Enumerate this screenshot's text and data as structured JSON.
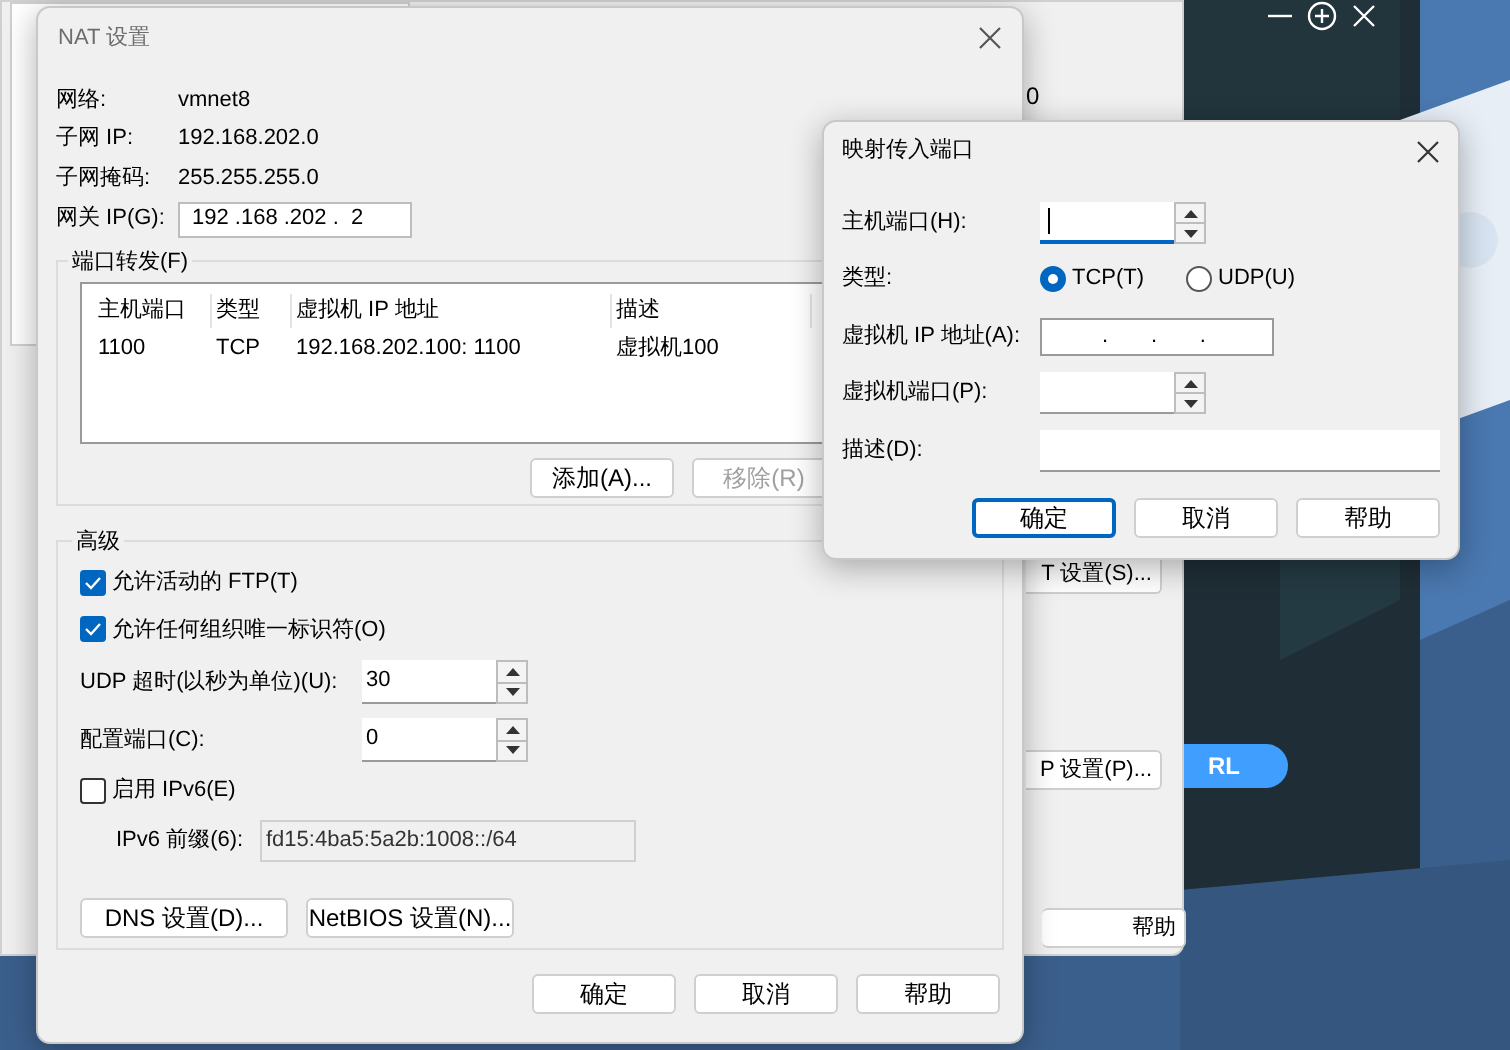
{
  "background_window": {
    "value_fragment": "0",
    "buttons": [
      {
        "label": "T 设置(S)..."
      },
      {
        "label": "P 设置(P)..."
      },
      {
        "label": "帮助"
      }
    ]
  },
  "background_app": {
    "button_fragment": "RL"
  },
  "nat_window": {
    "title": "NAT 设置",
    "info": [
      {
        "label": "网络:",
        "value": "vmnet8"
      },
      {
        "label": "子网 IP:",
        "value": "192.168.202.0"
      },
      {
        "label": "子网掩码:",
        "value": "255.255.255.0"
      }
    ],
    "gateway": {
      "label": "网关 IP(G):",
      "value": "192 .168 .202 .  2"
    },
    "port_forwarding": {
      "title": "端口转发(F)",
      "columns": [
        "主机端口",
        "类型",
        "虚拟机 IP 地址",
        "描述"
      ],
      "rows": [
        [
          "1100",
          "TCP",
          "192.168.202.100: 1100",
          "虚拟机100"
        ]
      ],
      "buttons": [
        {
          "label": "添加(A)...",
          "disabled": false
        },
        {
          "label": "移除(R)",
          "disabled": true
        }
      ]
    },
    "advanced": {
      "title": "高级",
      "checkboxes": [
        {
          "label": "允许活动的 FTP(T)",
          "checked": true
        },
        {
          "label": "允许任何组织唯一标识符(O)",
          "checked": true
        }
      ],
      "spinners": [
        {
          "label": "UDP 超时(以秒为单位)(U):",
          "value": "30"
        },
        {
          "label": "配置端口(C):",
          "value": "0"
        }
      ],
      "ipv6": {
        "label": "启用 IPv6(E)",
        "checked": false
      },
      "prefix": {
        "label": "IPv6 前缀(6):",
        "value": "fd15:4ba5:5a2b:1008::/64",
        "disabled": true
      },
      "buttons": [
        "DNS 设置(D)...",
        "NetBIOS 设置(N)..."
      ]
    },
    "buttons": [
      "确定",
      "取消",
      "帮助"
    ]
  },
  "map_dialog": {
    "title": "映射传入端口",
    "host_port": {
      "label": "主机端口(H):",
      "focused": true
    },
    "type": {
      "label": "类型:",
      "options": [
        {
          "label": "TCP(T)",
          "selected": true
        },
        {
          "label": "UDP(U)",
          "selected": false
        }
      ]
    },
    "vm_ip": {
      "label": "虚拟机 IP 地址(A):",
      "value": ".       .       ."
    },
    "vm_port": {
      "label": "虚拟机端口(P):"
    },
    "description": {
      "label": "描述(D):"
    },
    "buttons": [
      {
        "label": "确定",
        "default": true
      },
      {
        "label": "取消",
        "default": false
      },
      {
        "label": "帮助",
        "default": false
      }
    ]
  }
}
